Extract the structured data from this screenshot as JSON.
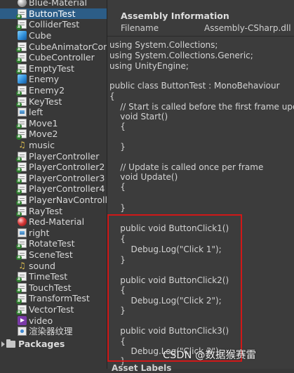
{
  "project": {
    "assets": [
      {
        "name": "Blue-Material",
        "icon": "material-icon"
      },
      {
        "name": "ButtonTest",
        "icon": "script-icon",
        "selected": true
      },
      {
        "name": "ColliderTest",
        "icon": "script-icon"
      },
      {
        "name": "Cube",
        "icon": "prefab-icon"
      },
      {
        "name": "CubeAnimatorCont",
        "icon": "script-icon"
      },
      {
        "name": "CubeController",
        "icon": "script-icon"
      },
      {
        "name": "EmptyTest",
        "icon": "script-icon"
      },
      {
        "name": "Enemy",
        "icon": "prefab-icon"
      },
      {
        "name": "Enemy2",
        "icon": "script-icon"
      },
      {
        "name": "KeyTest",
        "icon": "script-icon"
      },
      {
        "name": "left",
        "icon": "image-icon"
      },
      {
        "name": "Move1",
        "icon": "script-icon"
      },
      {
        "name": "Move2",
        "icon": "script-icon"
      },
      {
        "name": "music",
        "icon": "audio-icon"
      },
      {
        "name": "PlayerController",
        "icon": "script-icon"
      },
      {
        "name": "PlayerController2",
        "icon": "script-icon"
      },
      {
        "name": "PlayerController3",
        "icon": "script-icon"
      },
      {
        "name": "PlayerController4",
        "icon": "script-icon"
      },
      {
        "name": "PlayerNavControlle",
        "icon": "script-icon"
      },
      {
        "name": "RayTest",
        "icon": "script-icon"
      },
      {
        "name": "Red-Material",
        "icon": "material-icon-red"
      },
      {
        "name": "right",
        "icon": "image-icon"
      },
      {
        "name": "RotateTest",
        "icon": "script-icon"
      },
      {
        "name": "SceneTest",
        "icon": "script-icon"
      },
      {
        "name": "sound",
        "icon": "audio-icon"
      },
      {
        "name": "TimeTest",
        "icon": "script-icon"
      },
      {
        "name": "TouchTest",
        "icon": "script-icon"
      },
      {
        "name": "TransformTest",
        "icon": "script-icon"
      },
      {
        "name": "VectorTest",
        "icon": "script-icon"
      },
      {
        "name": "video",
        "icon": "video-icon"
      },
      {
        "name": "渲染器纹理",
        "icon": "render-texture-icon"
      }
    ],
    "packages_label": "Packages"
  },
  "inspector": {
    "title": "Assembly Information",
    "filename_key": "Filename",
    "filename_value": "Assembly-CSharp.dll",
    "code_lines": [
      "using System.Collections;",
      "using System.Collections.Generic;",
      "using UnityEngine;",
      "",
      "public class ButtonTest : MonoBehaviour",
      "{",
      "    // Start is called before the first frame update",
      "    void Start()",
      "    {",
      "",
      "    }",
      "",
      "    // Update is called once per frame",
      "    void Update()",
      "    {",
      "",
      "    }",
      "",
      "    public void ButtonClick1()",
      "    {",
      "        Debug.Log(\"Click 1\");",
      "    }",
      "",
      "    public void ButtonClick2()",
      "    {",
      "        Debug.Log(\"Click 2\");",
      "    }",
      "",
      "    public void ButtonClick3()",
      "    {",
      "        Debug.Log(\"Click 3\");",
      "    }"
    ],
    "asset_labels": "Asset Labels"
  },
  "watermark": "CSDN @数据猴赛雷",
  "colors": {
    "selection": "#2c5d87",
    "highlight_box": "#d01818"
  }
}
